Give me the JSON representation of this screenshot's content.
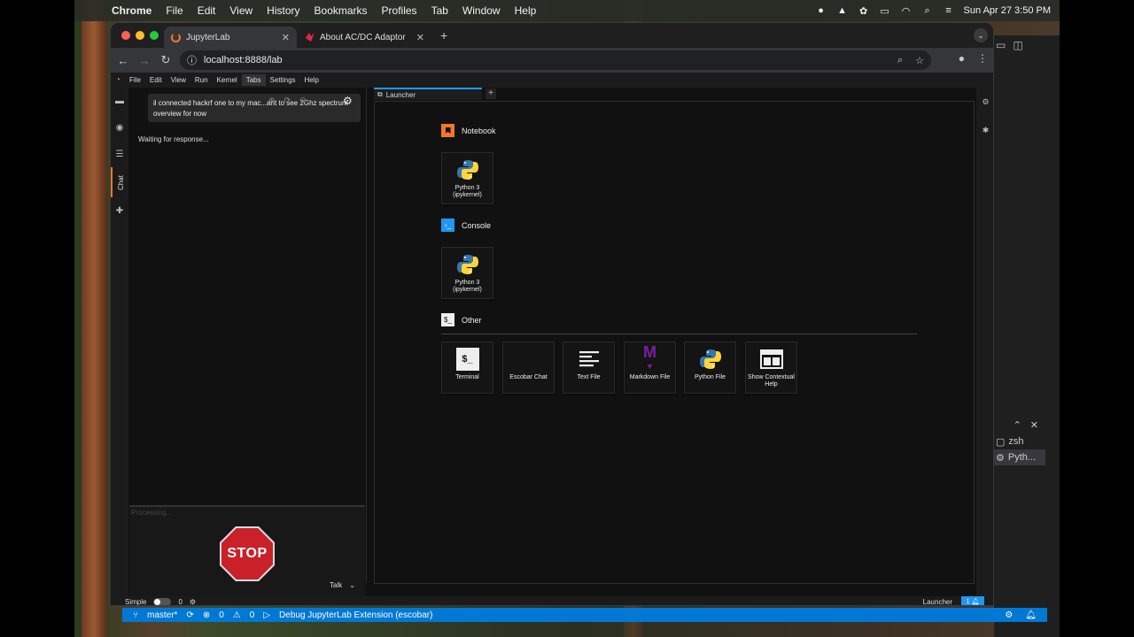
{
  "macmenu": {
    "app": "Chrome",
    "items": [
      "File",
      "Edit",
      "View",
      "History",
      "Bookmarks",
      "Profiles",
      "Tab",
      "Window",
      "Help"
    ],
    "clock": "Sun Apr 27  3:50 PM"
  },
  "browser": {
    "tabs": [
      {
        "title": "JupyterLab",
        "active": true
      },
      {
        "title": "About AC/DC Adaptor used w",
        "active": false
      }
    ],
    "url": "localhost:8888/lab"
  },
  "jupyter": {
    "menu": [
      "File",
      "Edit",
      "View",
      "Run",
      "Kernel",
      "Tabs",
      "Settings",
      "Help"
    ],
    "sidebar_chat_label": "Chat",
    "chat": {
      "message": "il connected hackrf one to my mac...ant to see 2Ghz spectrum overview for now",
      "waiting": "Waiting for response...",
      "input_placeholder": "Processing...",
      "stop_label": "STOP",
      "mode": "Talk"
    },
    "dock_tab": "Launcher",
    "launcher": {
      "sections": [
        {
          "title": "Notebook",
          "cards": [
            {
              "label": "Python 3 (ipykernel)",
              "icon": "python-icon"
            }
          ]
        },
        {
          "title": "Console",
          "cards": [
            {
              "label": "Python 3 (ipykernel)",
              "icon": "python-icon"
            }
          ]
        },
        {
          "title": "Other",
          "cards": [
            {
              "label": "Terminal",
              "icon": "terminal-icon"
            },
            {
              "label": "Escobar Chat",
              "icon": "none"
            },
            {
              "label": "Text File",
              "icon": "text-file-icon"
            },
            {
              "label": "Markdown File",
              "icon": "markdown-icon"
            },
            {
              "label": "Python File",
              "icon": "python-icon"
            },
            {
              "label": "Show Contextual Help",
              "icon": "help-icon"
            }
          ]
        }
      ]
    },
    "status": {
      "mode": "Simple",
      "count": "0",
      "right": "Launcher",
      "notif": "1"
    }
  },
  "vscode": {
    "terminals": [
      "zsh",
      "Pyth..."
    ],
    "status": {
      "branch": "master*",
      "problems": "0",
      "warnings": "0",
      "debug": "Debug JupyterLab Extension (escobar)"
    }
  },
  "colors": {
    "accent": "#2196f3",
    "jupyter_orange": "#f37726",
    "stop_red": "#c9202a",
    "vscode_blue": "#0078d4"
  }
}
